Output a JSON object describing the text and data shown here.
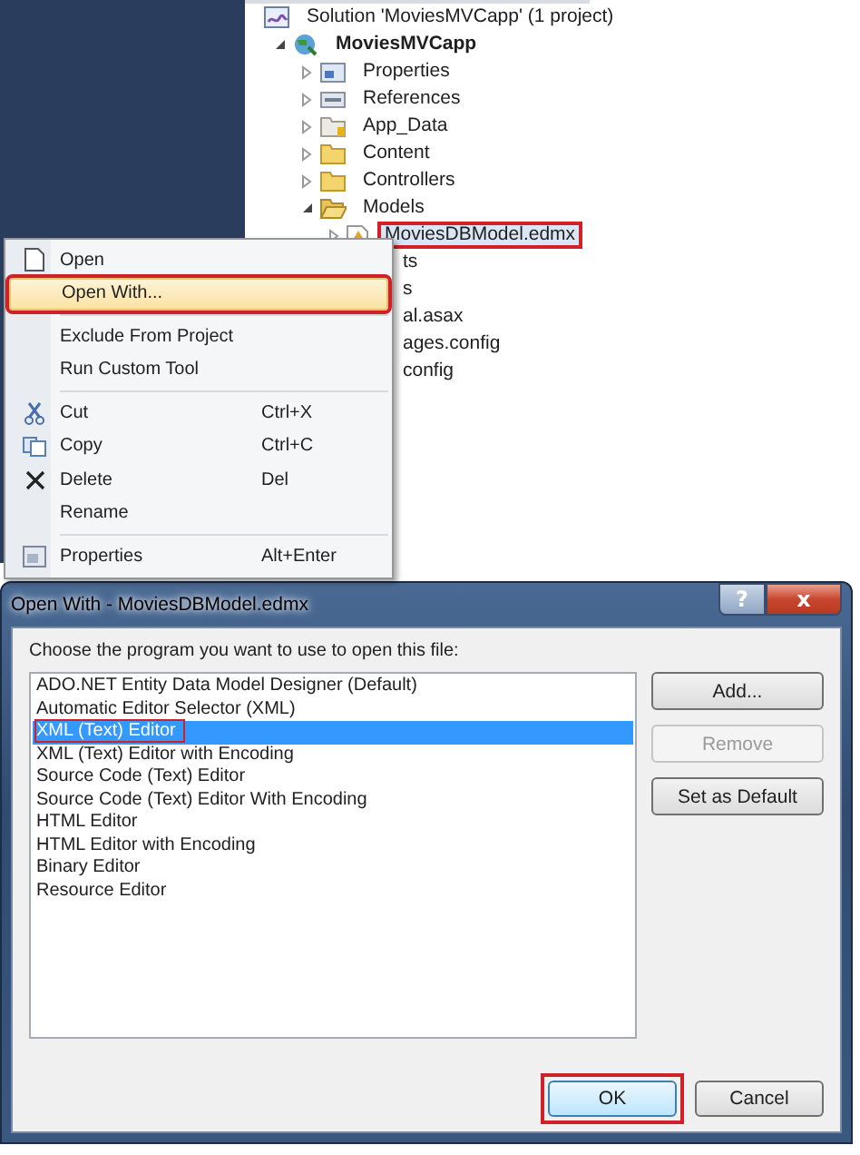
{
  "solution_explorer": {
    "items": [
      {
        "label": "Solution 'MoviesMVCapp' (1 project)",
        "kind": "solution",
        "selected": false,
        "annotated": false,
        "children": [
          {
            "label": "MoviesMVCapp",
            "kind": "project",
            "bold": true,
            "expanded": true,
            "selected": false,
            "annotated": false,
            "children": [
              {
                "label": "Properties",
                "kind": "properties",
                "expanded": false,
                "selected": false,
                "annotated": false
              },
              {
                "label": "References",
                "kind": "references",
                "expanded": false,
                "selected": false,
                "annotated": false
              },
              {
                "label": "App_Data",
                "kind": "data",
                "expanded": false,
                "selected": false,
                "annotated": false
              },
              {
                "label": "Content",
                "kind": "folder",
                "expanded": false,
                "selected": false,
                "annotated": false
              },
              {
                "label": "Controllers",
                "kind": "folder",
                "expanded": false,
                "selected": false,
                "annotated": false
              },
              {
                "label": "Models",
                "kind": "open-folder",
                "expanded": true,
                "selected": false,
                "annotated": false,
                "children": [
                  {
                    "label": "MoviesDBModel.edmx",
                    "kind": "edmx",
                    "expanded": false,
                    "selected": true,
                    "annotated": true
                  }
                ]
              },
              {
                "label": "ts",
                "kind": "covered",
                "selected": false,
                "annotated": false
              },
              {
                "label": "s",
                "kind": "covered",
                "selected": false,
                "annotated": false
              },
              {
                "label": "al.asax",
                "kind": "covered",
                "selected": false,
                "annotated": false
              },
              {
                "label": "ages.config",
                "kind": "covered",
                "selected": false,
                "annotated": false
              },
              {
                "label": "config",
                "kind": "covered",
                "selected": false,
                "annotated": false
              }
            ]
          }
        ]
      }
    ]
  },
  "context_menu": {
    "items": [
      {
        "kind": "open",
        "label": "Open",
        "selected": false,
        "annotated": false
      },
      {
        "kind": "plain",
        "label": "Open With...",
        "selected": true,
        "annotated": true
      },
      {
        "kind": "separator"
      },
      {
        "kind": "plain",
        "label": "Exclude From Project",
        "selected": false,
        "annotated": false
      },
      {
        "kind": "plain",
        "label": "Run Custom Tool",
        "selected": false,
        "annotated": false
      },
      {
        "kind": "separator"
      },
      {
        "kind": "cut",
        "label": "Cut",
        "shortcut": "Ctrl+X",
        "selected": false,
        "annotated": false
      },
      {
        "kind": "copy",
        "label": "Copy",
        "shortcut": "Ctrl+C",
        "selected": false,
        "annotated": false
      },
      {
        "kind": "delete",
        "label": "Delete",
        "shortcut": "Del",
        "selected": false,
        "annotated": false
      },
      {
        "kind": "plain",
        "label": "Rename",
        "selected": false,
        "annotated": false
      },
      {
        "kind": "separator"
      },
      {
        "kind": "properties",
        "label": "Properties",
        "shortcut": "Alt+Enter",
        "selected": false,
        "annotated": false
      }
    ]
  },
  "dialog": {
    "title": "Open With - MoviesDBModel.edmx",
    "help_button": "?",
    "close_button": "x",
    "prompt": "Choose the program you want to use to open this file:",
    "programs": [
      {
        "label": "ADO.NET Entity Data Model Designer (Default)",
        "selected": false,
        "annotated": false
      },
      {
        "label": "Automatic Editor Selector (XML)",
        "selected": false,
        "annotated": false
      },
      {
        "label": "XML (Text) Editor",
        "selected": true,
        "annotated": true
      },
      {
        "label": "XML (Text) Editor with Encoding",
        "selected": false,
        "annotated": false
      },
      {
        "label": "Source Code (Text) Editor",
        "selected": false,
        "annotated": false
      },
      {
        "label": "Source Code (Text) Editor With Encoding",
        "selected": false,
        "annotated": false
      },
      {
        "label": "HTML Editor",
        "selected": false,
        "annotated": false
      },
      {
        "label": "HTML Editor with Encoding",
        "selected": false,
        "annotated": false
      },
      {
        "label": "Binary Editor",
        "selected": false,
        "annotated": false
      },
      {
        "label": "Resource Editor",
        "selected": false,
        "annotated": false
      }
    ],
    "side_buttons": [
      {
        "label": "Add...",
        "disabled": false
      },
      {
        "label": "Remove",
        "disabled": true
      },
      {
        "label": "Set as Default",
        "disabled": false
      }
    ],
    "footer_buttons": [
      {
        "label": "OK",
        "default": true,
        "annotated": true
      },
      {
        "label": "Cancel",
        "default": false,
        "annotated": false
      }
    ]
  }
}
